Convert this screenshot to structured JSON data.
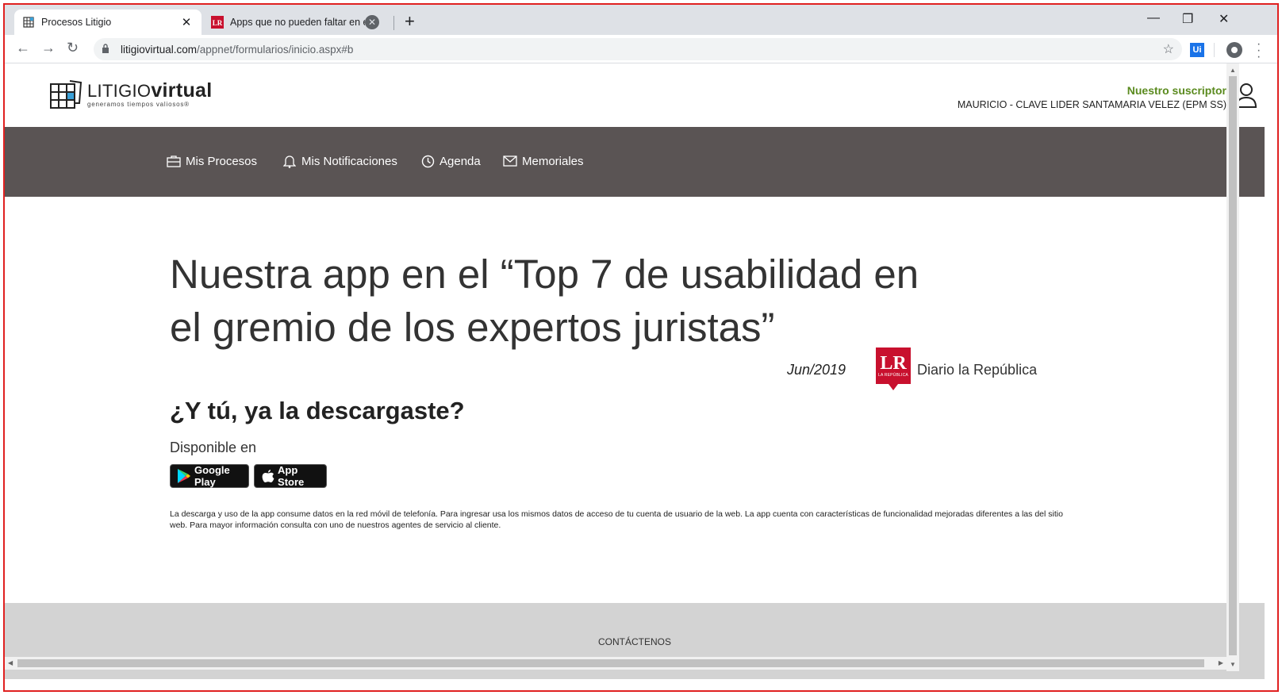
{
  "browser": {
    "tabs": [
      {
        "label": "Procesos Litigio",
        "favicon": "grid-logo-icon",
        "active": true
      },
      {
        "label": "Apps que no pueden faltar en el",
        "favicon": "lr-icon",
        "active": false
      }
    ],
    "address": {
      "host": "litigiovirtual.com",
      "path": "/appnet/formularios/inicio.aspx#b"
    },
    "extension_label": "Ui",
    "colors": {
      "tabbar": "#dee1e6",
      "frame_border": "#e02020"
    }
  },
  "site": {
    "logo": {
      "name_light": "LITIGIO",
      "name_bold": "virtual",
      "tagline": "generamos tiempos valiosos®"
    },
    "subscriber": {
      "title": "Nuestro suscriptor",
      "name": "MAURICIO - CLAVE LIDER SANTAMARIA VELEZ (EPM SS)"
    },
    "nav": [
      {
        "label": "Mis Procesos",
        "icon": "briefcase-icon"
      },
      {
        "label": "Mis Notificaciones",
        "icon": "bell-icon"
      },
      {
        "label": "Agenda",
        "icon": "clock-icon"
      },
      {
        "label": "Memoriales",
        "icon": "envelope-icon"
      }
    ],
    "hero": {
      "title": "Nuestra app en el “Top 7 de usabilidad en el gremio de los expertos juristas”",
      "date": "Jun/2019",
      "source_logo": "LR",
      "source_logo_sub": "LA REPÚBLICA",
      "source": "Diario la República"
    },
    "cta": "¿Y tú, ya la descargaste?",
    "available": "Disponible en",
    "stores": [
      {
        "label": "Google Play",
        "icon": "google-play-icon"
      },
      {
        "label": "App Store",
        "icon": "apple-icon"
      }
    ],
    "disclaimer": "La descarga y uso de la app consume datos en la red móvil de telefonía. Para ingresar usa los mismos datos de acceso de tu cuenta de usuario de la web. La app cuenta con características de funcionalidad mejoradas diferentes a las del sitio web. Para mayor información consulta con uno de nuestros agentes de servicio al cliente.",
    "footer": {
      "link": "CONTÁCTENOS"
    },
    "colors": {
      "nav_bg": "#5a5454",
      "subscriber_green": "#5a8a1e",
      "lr_red": "#c8102e",
      "footer_bg": "#d3d3d3"
    }
  }
}
